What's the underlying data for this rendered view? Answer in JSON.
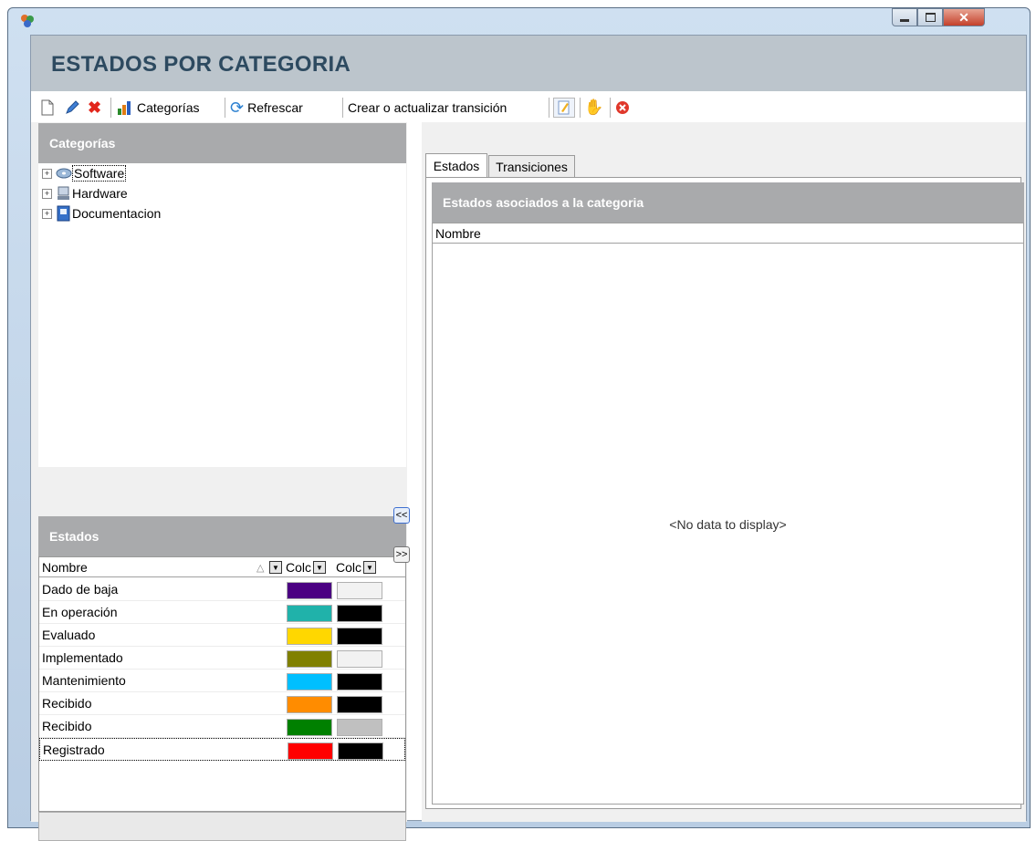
{
  "window": {
    "title": ""
  },
  "header": {
    "title": "ESTADOS POR CATEGORIA"
  },
  "toolbar": {
    "categorias": "Categorías",
    "refrescar": "Refrescar",
    "crear_transicion": "Crear o actualizar transición"
  },
  "categorias_panel": {
    "title": "Categorías",
    "nodes": [
      {
        "label": "Software",
        "icon": "software-icon",
        "selected": true
      },
      {
        "label": "Hardware",
        "icon": "computer-icon",
        "selected": false
      },
      {
        "label": "Documentacion",
        "icon": "document-icon",
        "selected": false
      }
    ]
  },
  "estados_panel": {
    "title": "Estados",
    "columns": {
      "name": "Nombre",
      "color1": "Colc",
      "color2": "Colc"
    },
    "rows": [
      {
        "name": "Dado de baja",
        "color": "#4b0082",
        "text_color": "#f2f2f2"
      },
      {
        "name": "En operación",
        "color": "#20b2aa",
        "text_color": "#000000"
      },
      {
        "name": "Evaluado",
        "color": "#ffd700",
        "text_color": "#000000"
      },
      {
        "name": "Implementado",
        "color": "#808000",
        "text_color": "#f2f2f2"
      },
      {
        "name": "Mantenimiento",
        "color": "#00bfff",
        "text_color": "#000000"
      },
      {
        "name": "Recibido",
        "color": "#ff8c00",
        "text_color": "#000000"
      },
      {
        "name": "Recibido",
        "color": "#008000",
        "text_color": "#c0c0c0"
      },
      {
        "name": "Registrado",
        "color": "#ff0000",
        "text_color": "#000000"
      }
    ]
  },
  "transfer": {
    "left": "<<",
    "right": ">>"
  },
  "tabs": [
    {
      "label": "Estados"
    },
    {
      "label": "Transiciones"
    }
  ],
  "asociados": {
    "title": "Estados asociados a la categoria",
    "column": "Nombre",
    "empty": "<No data to display>"
  }
}
